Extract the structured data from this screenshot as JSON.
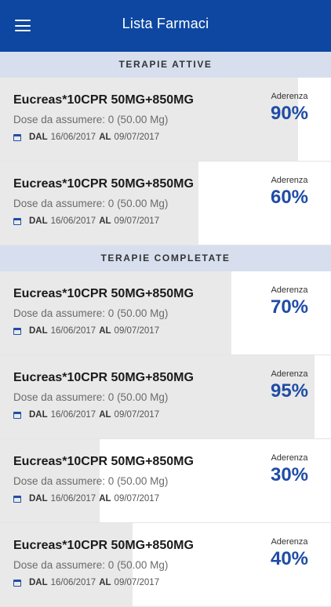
{
  "header": {
    "title": "Lista Farmaci",
    "menu_icon": "menu-icon"
  },
  "colors": {
    "appbar": "#0d47a1",
    "accent": "#1f4ca5",
    "section_bg": "#d7dfee",
    "progress_fill": "#e9e9e9"
  },
  "sections": [
    {
      "title": "TERAPIE ATTIVE",
      "items": [
        {
          "name": "Eucreas*10CPR 50MG+850MG",
          "dose": "Dose da assumere: 0 (50.00 Mg)",
          "from_label": "DAL",
          "from": "16/06/2017",
          "to_label": "AL",
          "to": "09/07/2017",
          "adherence_label": "Aderenza",
          "adherence": "90%",
          "adherence_fraction": 0.9
        },
        {
          "name": "Eucreas*10CPR 50MG+850MG",
          "dose": "Dose da assumere: 0 (50.00 Mg)",
          "from_label": "DAL",
          "from": "16/06/2017",
          "to_label": "AL",
          "to": "09/07/2017",
          "adherence_label": "Aderenza",
          "adherence": "60%",
          "adherence_fraction": 0.6
        }
      ]
    },
    {
      "title": "TERAPIE COMPLETATE",
      "items": [
        {
          "name": "Eucreas*10CPR 50MG+850MG",
          "dose": "Dose da assumere: 0 (50.00 Mg)",
          "from_label": "DAL",
          "from": "16/06/2017",
          "to_label": "AL",
          "to": "09/07/2017",
          "adherence_label": "Aderenza",
          "adherence": "70%",
          "adherence_fraction": 0.7
        },
        {
          "name": "Eucreas*10CPR 50MG+850MG",
          "dose": "Dose da assumere: 0 (50.00 Mg)",
          "from_label": "DAL",
          "from": "16/06/2017",
          "to_label": "AL",
          "to": "09/07/2017",
          "adherence_label": "Aderenza",
          "adherence": "95%",
          "adherence_fraction": 0.95
        },
        {
          "name": "Eucreas*10CPR 50MG+850MG",
          "dose": "Dose da assumere: 0 (50.00 Mg)",
          "from_label": "DAL",
          "from": "16/06/2017",
          "to_label": "AL",
          "to": "09/07/2017",
          "adherence_label": "Aderenza",
          "adherence": "30%",
          "adherence_fraction": 0.3
        },
        {
          "name": "Eucreas*10CPR 50MG+850MG",
          "dose": "Dose da assumere: 0 (50.00 Mg)",
          "from_label": "DAL",
          "from": "16/06/2017",
          "to_label": "AL",
          "to": "09/07/2017",
          "adherence_label": "Aderenza",
          "adherence": "40%",
          "adherence_fraction": 0.4
        }
      ]
    }
  ]
}
